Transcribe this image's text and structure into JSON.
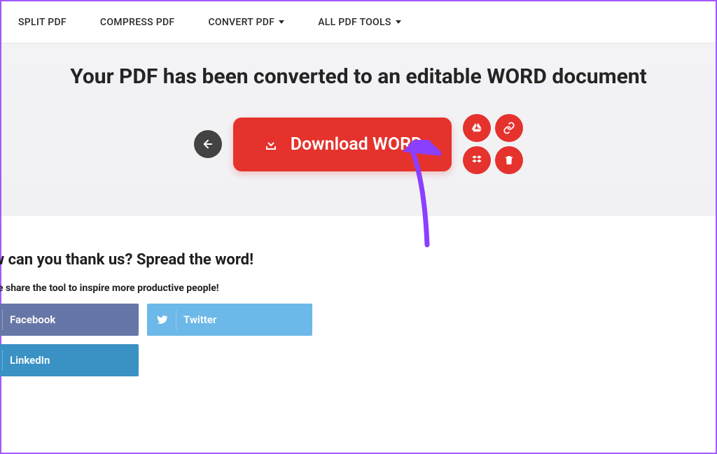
{
  "nav": {
    "items": [
      {
        "label": "SPLIT PDF",
        "has_caret": false
      },
      {
        "label": "COMPRESS PDF",
        "has_caret": false
      },
      {
        "label": "CONVERT PDF",
        "has_caret": true
      },
      {
        "label": "ALL PDF TOOLS",
        "has_caret": true
      }
    ]
  },
  "hero": {
    "title": "Your PDF has been converted to an editable WORD document",
    "download_label": "Download WORD"
  },
  "thanks": {
    "title": "How can you thank us? Spread the word!",
    "subtitle": "Please share the tool to inspire more productive people!",
    "share": {
      "facebook": "Facebook",
      "twitter": "Twitter",
      "linkedin": "LinkedIn"
    }
  },
  "colors": {
    "primary_red": "#e5322d",
    "arrow": "#8b3fff"
  }
}
